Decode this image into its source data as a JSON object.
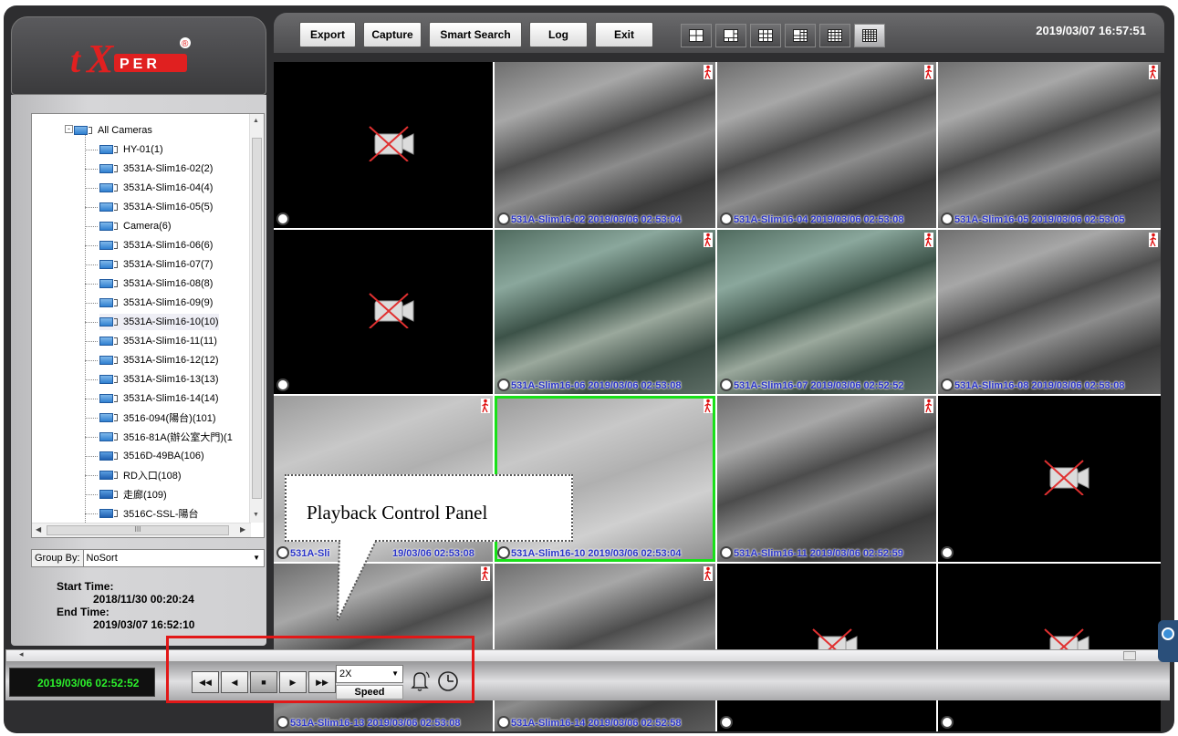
{
  "app": {
    "logo_text": "tXPER",
    "logo_reg": "®"
  },
  "toolbar": {
    "export": "Export",
    "capture": "Capture",
    "smart_search": "Smart Search",
    "log": "Log",
    "exit": "Exit",
    "datetime": "2019/03/07 16:57:51",
    "layouts": [
      "layout-2x2",
      "layout-1plus5",
      "layout-3x3",
      "layout-1plus7",
      "layout-4x4",
      "layout-5x5"
    ],
    "active_layout": "layout-5x5"
  },
  "sidebar": {
    "root_label": "All Cameras",
    "cameras": [
      "HY-01(1)",
      "3531A-Slim16-02(2)",
      "3531A-Slim16-04(4)",
      "3531A-Slim16-05(5)",
      "Camera(6)",
      "3531A-Slim16-06(6)",
      "3531A-Slim16-07(7)",
      "3531A-Slim16-08(8)",
      "3531A-Slim16-09(9)",
      "3531A-Slim16-10(10)",
      "3531A-Slim16-11(11)",
      "3531A-Slim16-12(12)",
      "3531A-Slim16-13(13)",
      "3531A-Slim16-14(14)",
      "3516-094(陽台)(101)",
      "3516-81A(辦公室大門)(1",
      "3516D-49BA(106)",
      "RD入口(108)",
      "走廊(109)",
      "3516C-SSL-陽台"
    ],
    "scroll_mark": "III",
    "group_by_label": "Group By:",
    "group_by_value": "NoSort",
    "start_time_label": "Start Time:",
    "start_time": "2018/11/30 00:20:24",
    "end_time_label": "End Time:",
    "end_time": "2019/03/07 16:52:10"
  },
  "grid": {
    "tiles": [
      {
        "caption": "",
        "kind": "nocam"
      },
      {
        "caption": "531A-Slim16-02 2019/03/06 02:53:04",
        "kind": "cam"
      },
      {
        "caption": "531A-Slim16-04 2019/03/06 02:53:08",
        "kind": "cam"
      },
      {
        "caption": "531A-Slim16-05 2019/03/06 02:53:05",
        "kind": "cam"
      },
      {
        "caption": "",
        "kind": "nocam"
      },
      {
        "caption": "531A-Slim16-06 2019/03/06 02:53:08",
        "kind": "cam"
      },
      {
        "caption": "531A-Slim16-07 2019/03/06 02:52:52",
        "kind": "cam"
      },
      {
        "caption": "531A-Slim16-08 2019/03/06 02:53:08",
        "kind": "cam"
      },
      {
        "caption": "531A-Sli",
        "caption2": "19/03/06 02:53:08",
        "kind": "cam"
      },
      {
        "caption": "531A-Slim16-10 2019/03/06 02:53:04",
        "kind": "cam",
        "selected": true
      },
      {
        "caption": "531A-Slim16-11 2019/03/06 02:52:59",
        "kind": "cam"
      },
      {
        "caption": "",
        "kind": "nocam"
      },
      {
        "caption": "531A-Slim16-13 2019/03/06 02:53:08",
        "kind": "cam"
      },
      {
        "caption": "531A-Slim16-14 2019/03/06 02:52:58",
        "kind": "cam"
      },
      {
        "caption": "",
        "kind": "nocam"
      },
      {
        "caption": "",
        "kind": "nocam"
      }
    ]
  },
  "playback": {
    "current_time": "2019/03/06 02:52:52",
    "speed_value": "2X",
    "speed_label": "Speed",
    "buttons": [
      "rewind",
      "step-back",
      "stop",
      "play",
      "fast-forward"
    ]
  },
  "annotation": {
    "callout_text": "Playback Control Panel"
  },
  "colors": {
    "highlight": "#e21818",
    "selected_tile": "#19e019",
    "caption": "#2a34c8",
    "time_green": "#2cf02c"
  }
}
